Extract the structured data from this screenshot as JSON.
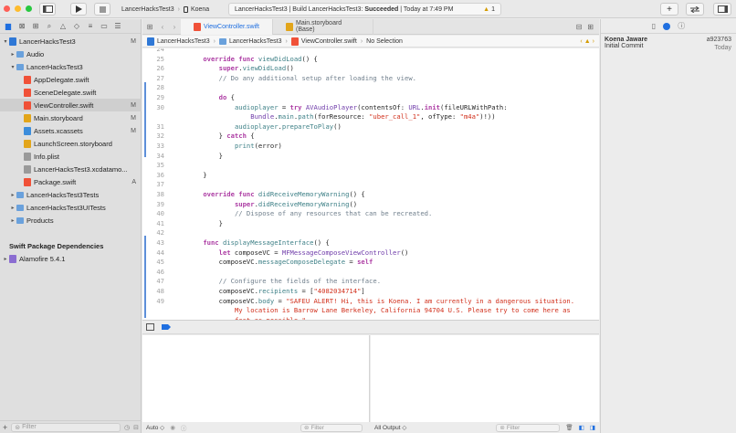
{
  "toolbar": {
    "scheme": "LancerHacksTest3",
    "device": "Koena",
    "activity_prefix": "LancerHacksTest3 | Build LancerHacksTest3:",
    "activity_status": "Succeeded",
    "activity_time": "| Today at 7:49 PM",
    "warning_count": "1",
    "add_label": "+",
    "icons": [
      "sidebar-toggle-icon",
      "run-icon",
      "stop-icon",
      "library-icon",
      "code-review-icon",
      "inspector-toggle-icon"
    ]
  },
  "navigator": {
    "tree": [
      {
        "label": "LancerHacksTest3",
        "badge": "M",
        "icon": "proj",
        "indent": 0,
        "disclosure": "▾"
      },
      {
        "label": "Audio",
        "badge": "",
        "icon": "folder",
        "indent": 1,
        "disclosure": "▸"
      },
      {
        "label": "LancerHacksTest3",
        "badge": "",
        "icon": "folder",
        "indent": 1,
        "disclosure": "▾"
      },
      {
        "label": "AppDelegate.swift",
        "badge": "",
        "icon": "swift",
        "indent": 2,
        "disclosure": ""
      },
      {
        "label": "SceneDelegate.swift",
        "badge": "",
        "icon": "swift",
        "indent": 2,
        "disclosure": ""
      },
      {
        "label": "ViewController.swift",
        "badge": "M",
        "icon": "swift",
        "indent": 2,
        "disclosure": "",
        "selected": true
      },
      {
        "label": "Main.storyboard",
        "badge": "M",
        "icon": "sb",
        "indent": 2,
        "disclosure": ""
      },
      {
        "label": "Assets.xcassets",
        "badge": "M",
        "icon": "assets",
        "indent": 2,
        "disclosure": ""
      },
      {
        "label": "LaunchScreen.storyboard",
        "badge": "",
        "icon": "sb",
        "indent": 2,
        "disclosure": ""
      },
      {
        "label": "Info.plist",
        "badge": "",
        "icon": "plist",
        "indent": 2,
        "disclosure": ""
      },
      {
        "label": "LancerHacksTest3.xcdatamo...",
        "badge": "",
        "icon": "plist",
        "indent": 2,
        "disclosure": ""
      },
      {
        "label": "Package.swift",
        "badge": "A",
        "icon": "swift",
        "indent": 2,
        "disclosure": ""
      },
      {
        "label": "LancerHacksTest3Tests",
        "badge": "",
        "icon": "folder",
        "indent": 1,
        "disclosure": "▸"
      },
      {
        "label": "LancerHacksTest3UITests",
        "badge": "",
        "icon": "folder",
        "indent": 1,
        "disclosure": "▸"
      },
      {
        "label": "Products",
        "badge": "",
        "icon": "folder",
        "indent": 1,
        "disclosure": "▸"
      },
      {
        "label": "",
        "badge": "",
        "icon": "",
        "indent": 0,
        "disclosure": "",
        "spacer": true
      },
      {
        "label": "Swift Package Dependencies",
        "badge": "",
        "icon": "",
        "indent": 0,
        "disclosure": "",
        "header": true
      },
      {
        "label": "Alamofire 5.4.1",
        "badge": "",
        "icon": "pkg",
        "indent": 0,
        "disclosure": "▸"
      }
    ],
    "filter_placeholder": "Filter"
  },
  "editor": {
    "tabs": [
      {
        "label": "ViewController.swift",
        "active": true
      },
      {
        "label": "Main.storyboard (Base)",
        "active": false
      }
    ],
    "breadcrumb": [
      "LancerHacksTest3",
      "LancerHacksTest3",
      "ViewController.swift",
      "No Selection"
    ],
    "lines": [
      {
        "n": "24",
        "html": ""
      },
      {
        "n": "25",
        "html": "    <span class=\"kw\">override func</span> <span class=\"fn\">viewDidLoad</span>() {"
      },
      {
        "n": "26",
        "html": "        <span class=\"kw\">super</span>.<span class=\"fn\">viewDidLoad</span>()"
      },
      {
        "n": "27",
        "html": "        <span class=\"cm\">// Do any additional setup after loading the view.</span>"
      },
      {
        "n": "28",
        "html": ""
      },
      {
        "n": "29",
        "html": "        <span class=\"kw\">do</span> {"
      },
      {
        "n": "30",
        "html": "            <span class=\"fn\">audioplayer</span> = <span class=\"kw\">try</span> <span class=\"ty\">AVAudioPlayer</span>(contentsOf: <span class=\"ty\">URL</span>.<span class=\"kw\">init</span>(fileURLWithPath:"
      },
      {
        "n": "",
        "html": "                <span class=\"ty\">Bundle</span>.<span class=\"fn\">main</span>.<span class=\"fn\">path</span>(forResource: <span class=\"st\">\"uber_call_1\"</span>, ofType: <span class=\"st\">\"m4a\"</span>)!))"
      },
      {
        "n": "31",
        "html": "            <span class=\"fn\">audioplayer</span>.<span class=\"fn\">prepareToPlay</span>()"
      },
      {
        "n": "32",
        "html": "        } <span class=\"kw\">catch</span> {"
      },
      {
        "n": "33",
        "html": "            <span class=\"fn\">print</span>(error)"
      },
      {
        "n": "34",
        "html": "        }"
      },
      {
        "n": "35",
        "html": ""
      },
      {
        "n": "36",
        "html": "    }"
      },
      {
        "n": "37",
        "html": ""
      },
      {
        "n": "38",
        "html": "    <span class=\"kw\">override func</span> <span class=\"fn\">didReceiveMemoryWarning</span>() {"
      },
      {
        "n": "39",
        "html": "            <span class=\"kw\">super</span>.<span class=\"fn\">didReceiveMemoryWarning</span>()"
      },
      {
        "n": "40",
        "html": "            <span class=\"cm\">// Dispose of any resources that can be recreated.</span>"
      },
      {
        "n": "41",
        "html": "        }"
      },
      {
        "n": "42",
        "html": ""
      },
      {
        "n": "43",
        "html": "    <span class=\"kw\">func</span> <span class=\"fn\">displayMessageInterface</span>() {"
      },
      {
        "n": "44",
        "html": "        <span class=\"kw\">let</span> composeVC = <span class=\"ty\">MFMessageComposeViewController</span>()"
      },
      {
        "n": "45",
        "html": "        composeVC.<span class=\"fn\">messageComposeDelegate</span> = <span class=\"kw\">self</span>"
      },
      {
        "n": "46",
        "html": ""
      },
      {
        "n": "47",
        "html": "        <span class=\"cm\">// Configure the fields of the interface.</span>"
      },
      {
        "n": "48",
        "html": "        composeVC.<span class=\"fn\">recipients</span> = [<span class=\"st\">\"4082034714\"</span>]"
      },
      {
        "n": "49",
        "html": "        composeVC.<span class=\"fn\">body</span> = <span class=\"st\">\"SAFEU ALERT! Hi, this is Koena. I am currently in a dangerous situation.</span>"
      },
      {
        "n": "",
        "html": "            <span class=\"st\">My location is Barrow Lane Berkeley, California 94704 U.S. Please try to come here as</span>"
      },
      {
        "n": "",
        "html": "            <span class=\"st\">fast as possible.\"</span>"
      }
    ]
  },
  "debug": {
    "scope": "Auto ◇",
    "variables_filter": "Filter",
    "output_selector": "All Output ◇",
    "console_filter": "Filter"
  },
  "inspector": {
    "author": "Koena Jaware",
    "hash": "a923763",
    "message": "Initial Commit",
    "date": "Today"
  },
  "colors": {
    "accent": "#1f6fe0",
    "success": "#222222",
    "warning": "#d49b00",
    "swift_file": "#f05138"
  }
}
